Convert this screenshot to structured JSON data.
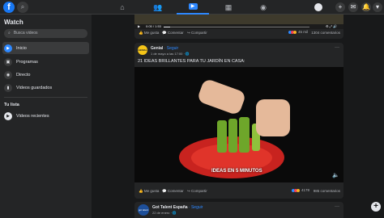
{
  "topbar": {
    "logo": "f",
    "search_icon": "⌕",
    "tabs": [
      {
        "icon": "home-icon",
        "glyph": "⌂"
      },
      {
        "icon": "friends-icon",
        "glyph": "👥"
      },
      {
        "icon": "watch-icon",
        "glyph": "▶"
      },
      {
        "icon": "marketplace-icon",
        "glyph": "▦"
      },
      {
        "icon": "groups-icon",
        "glyph": "◉"
      }
    ],
    "right": [
      "+",
      "✉",
      "🔔",
      "▾"
    ]
  },
  "sidebar": {
    "title": "Watch",
    "search_placeholder": "Busca videos",
    "items": [
      {
        "label": "Inicio",
        "glyph": "▶"
      },
      {
        "label": "Programas",
        "glyph": "▣"
      },
      {
        "label": "Directo",
        "glyph": "◉"
      },
      {
        "label": "Videos guardados",
        "glyph": "▮"
      }
    ],
    "list_title": "Tu lista",
    "list_items": [
      {
        "label": "Videos recientes",
        "glyph": "▶"
      }
    ]
  },
  "post1": {
    "time": "0:05 / 1:53",
    "like": "Me gusta",
    "comment": "Comentar",
    "share": "Compartir",
    "reactions": "45 mil",
    "comments": "1304 comentarios"
  },
  "post2": {
    "avatar_text": "GENIAL",
    "author": "Genial",
    "follow": " · Seguir",
    "meta": "1 de mayo a las 17:00 · 🌐",
    "text": "21 IDEAS BRILLANTES PARA TU JARDÍN EN CASA:",
    "caption": "IDEAS EN 5 MINUTOS",
    "like": "Me gusta",
    "comment": "Comentar",
    "share": "Compartir",
    "reactions": "4178",
    "comments": "985 comentarios"
  },
  "post3": {
    "avatar_text": "got talent",
    "author": "Got Talent España",
    "follow": " · Seguir",
    "meta": "22 de enero · 🌐"
  },
  "fab": "+",
  "colors": {
    "accent": "#2d88ff",
    "background": "#18191a",
    "surface": "#242526"
  }
}
